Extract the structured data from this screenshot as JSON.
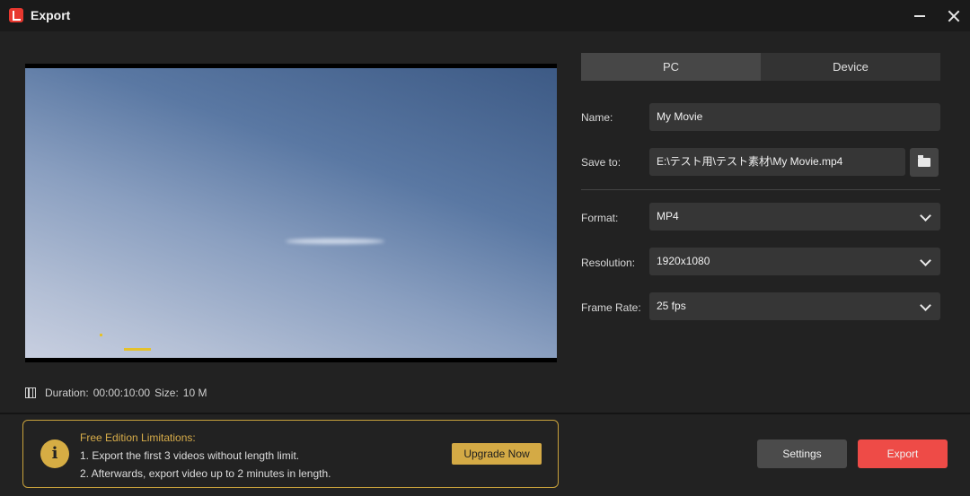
{
  "window": {
    "title": "Export"
  },
  "tabs": [
    {
      "label": "PC",
      "active": true
    },
    {
      "label": "Device",
      "active": false
    }
  ],
  "form": {
    "name_label": "Name:",
    "name_value": "My Movie",
    "save_label": "Save to:",
    "save_value": "E:\\テスト用\\テスト素材\\My Movie.mp4",
    "format_label": "Format:",
    "format_value": "MP4",
    "resolution_label": "Resolution:",
    "resolution_value": "1920x1080",
    "framerate_label": "Frame Rate:",
    "framerate_value": "25 fps"
  },
  "info": {
    "duration_label": "Duration:",
    "duration_value": "00:00:10:00",
    "size_label": "Size:",
    "size_value": "10 M"
  },
  "limitations": {
    "title": "Free Edition Limitations:",
    "line1": "1. Export the first 3 videos without length limit.",
    "line2": "2. Afterwards, export video up to 2 minutes in length.",
    "upgrade_label": "Upgrade Now"
  },
  "buttons": {
    "settings": "Settings",
    "export": "Export"
  },
  "colors": {
    "accent": "#ee4b47",
    "gold": "#d4aa45"
  }
}
